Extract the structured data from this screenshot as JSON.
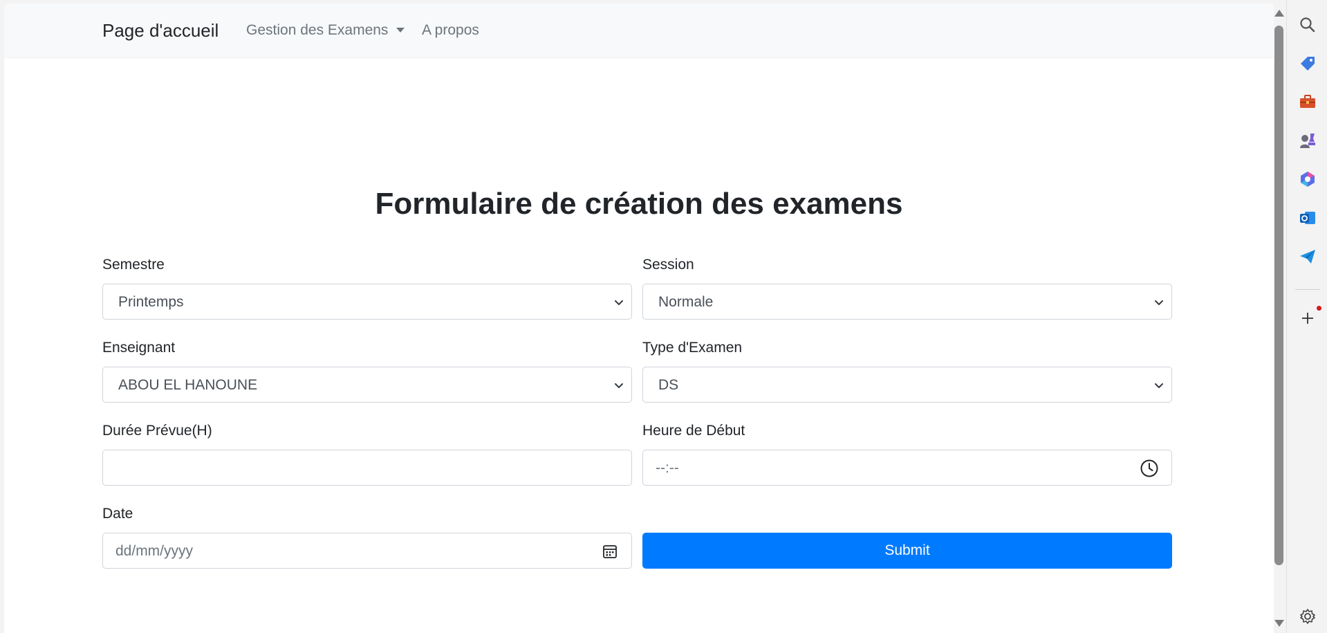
{
  "navbar": {
    "brand": "Page d'accueil",
    "exam_management": "Gestion des Examens",
    "about": "A propos"
  },
  "form": {
    "title": "Formulaire de création des examens",
    "semestre_label": "Semestre",
    "semestre_value": "Printemps",
    "session_label": "Session",
    "session_value": "Normale",
    "enseignant_label": "Enseignant",
    "enseignant_value": "ABOU EL HANOUNE",
    "type_label": "Type d'Examen",
    "type_value": "DS",
    "duree_label": "Durée Prévue(H)",
    "duree_value": "",
    "heure_label": "Heure de Début",
    "heure_placeholder": "--:--",
    "date_label": "Date",
    "date_placeholder": "dd/mm/yyyy",
    "submit_label": "Submit"
  },
  "colors": {
    "primary": "#007bff",
    "navbar_bg": "#f8f9fa",
    "input_border": "#ced4da"
  },
  "sidebar_icons": [
    "search-icon",
    "tag-icon",
    "toolbox-icon",
    "games-icon",
    "copilot-icon",
    "outlook-icon",
    "send-icon",
    "add-icon",
    "settings-icon"
  ]
}
